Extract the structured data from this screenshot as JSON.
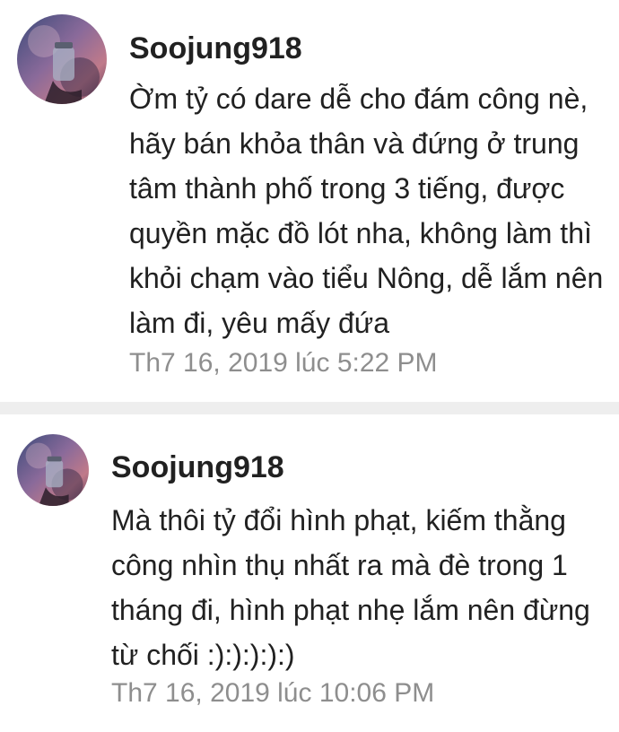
{
  "comments": [
    {
      "author": "Soojung918",
      "body": "Ờm tỷ có dare dễ cho đám công nè, hãy bán khỏa thân và đứng ở trung tâm thành phố trong 3 tiếng, được quyền mặc đồ lót nha, không làm thì khỏi chạm vào tiểu Nông, dễ lắm nên làm đi, yêu mấy đứa",
      "timestamp": "Th7 16, 2019 lúc 5:22 PM",
      "avatar_icon": "jar-avatar-icon"
    },
    {
      "author": "Soojung918",
      "body": "Mà thôi tỷ đổi hình phạt, kiếm thằng công nhìn thụ nhất ra mà đè trong 1 tháng đi, hình phạt nhẹ lắm nên đừng từ chối :):):):):)",
      "timestamp": "Th7 16, 2019 lúc 10:06 PM",
      "avatar_icon": "jar-avatar-icon"
    }
  ],
  "colors": {
    "text": "#212121",
    "timestamp": "#8e8e8e",
    "divider": "#eeeeee"
  }
}
